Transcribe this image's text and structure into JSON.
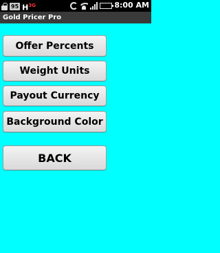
{
  "status_bar": {
    "notification_badge": "95",
    "h_label": "H",
    "h_superscript": "3G",
    "time": "8:00 AM",
    "battery_level_percent": 100,
    "icons": [
      "lock-icon",
      "wifi-icon",
      "sync-icon",
      "signal-icon",
      "battery-icon"
    ]
  },
  "title_bar": {
    "title": "Gold Pricer Pro"
  },
  "menu": {
    "offer_percents": "Offer Percents",
    "weight_units": "Weight Units",
    "payout_currency": "Payout Currency",
    "background_color": "Background Color",
    "back": "BACK"
  },
  "colors": {
    "background": "#00FFFF",
    "status_bar": "#000000",
    "title_bar": "#3A3A3A",
    "button": "#E6E6E6"
  }
}
